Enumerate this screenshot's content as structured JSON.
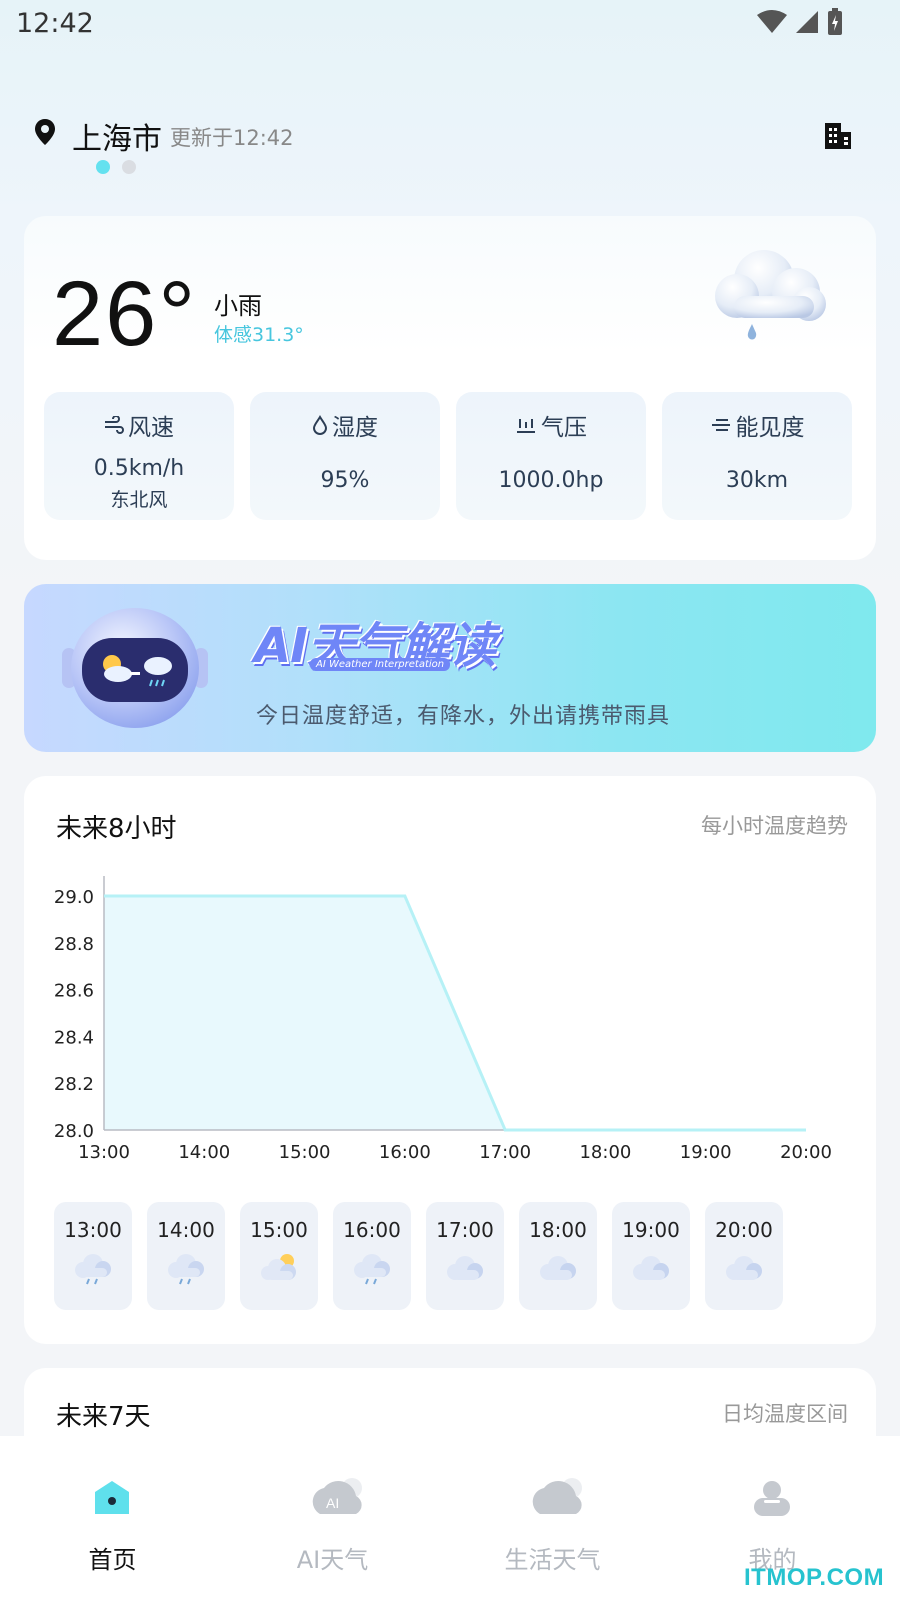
{
  "status_bar": {
    "time": "12:42"
  },
  "location": {
    "city": "上海市",
    "updated": "更新于12:42",
    "pages": 2,
    "active_page": 1
  },
  "current": {
    "temperature": "26°",
    "condition": "小雨",
    "feels_like": "体感31.3°",
    "metrics": [
      {
        "icon": "wind-icon",
        "title": "风速",
        "value": "0.5km/h",
        "sub": "东北风"
      },
      {
        "icon": "humidity-icon",
        "title": "湿度",
        "value": "95%",
        "sub": ""
      },
      {
        "icon": "pressure-icon",
        "title": "气压",
        "value": "1000.0hp",
        "sub": ""
      },
      {
        "icon": "visibility-icon",
        "title": "能见度",
        "value": "30km",
        "sub": ""
      }
    ]
  },
  "ai_banner": {
    "title": "AI天气解读",
    "subtitle_en": "AI Weather Interpretation",
    "text": "今日温度舒适，有降水，外出请携带雨具"
  },
  "hourly": {
    "title": "未来8小时",
    "right_label": "每小时温度趋势",
    "items": [
      {
        "time": "13:00",
        "icon": "rain-cloud-icon"
      },
      {
        "time": "14:00",
        "icon": "rain-cloud-icon"
      },
      {
        "time": "15:00",
        "icon": "partly-sunny-icon"
      },
      {
        "time": "16:00",
        "icon": "rain-cloud-icon"
      },
      {
        "time": "17:00",
        "icon": "cloud-icon"
      },
      {
        "time": "18:00",
        "icon": "cloud-icon"
      },
      {
        "time": "19:00",
        "icon": "cloud-icon"
      },
      {
        "time": "20:00",
        "icon": "cloud-icon"
      }
    ]
  },
  "chart_data": {
    "type": "area",
    "x": [
      "13:00",
      "14:00",
      "15:00",
      "16:00",
      "17:00",
      "18:00",
      "19:00",
      "20:00"
    ],
    "series": [
      {
        "values": [
          29.0,
          29.0,
          29.0,
          29.0,
          28.0,
          28.0,
          28.0,
          28.0
        ]
      }
    ],
    "yticks": [
      "29.0",
      "28.8",
      "28.6",
      "28.4",
      "28.2",
      "28.0"
    ],
    "ylim": [
      28.0,
      29.0
    ],
    "line_color": "#b6f1f6",
    "fill_color": "#e8f9fd",
    "grid": false
  },
  "weekly": {
    "title": "未来7天",
    "right_label": "日均温度区间"
  },
  "tabbar": {
    "tabs": [
      {
        "label": "首页",
        "icon": "home-icon",
        "active": true
      },
      {
        "label": "AI天气",
        "icon": "ai-weather-icon",
        "active": false
      },
      {
        "label": "生活天气",
        "icon": "life-weather-icon",
        "active": false
      },
      {
        "label": "我的",
        "icon": "profile-icon",
        "active": false
      }
    ]
  },
  "watermark": "ITMOP.COM",
  "colors": {
    "accent": "#64e1ef",
    "feels_like": "#47c6de"
  }
}
